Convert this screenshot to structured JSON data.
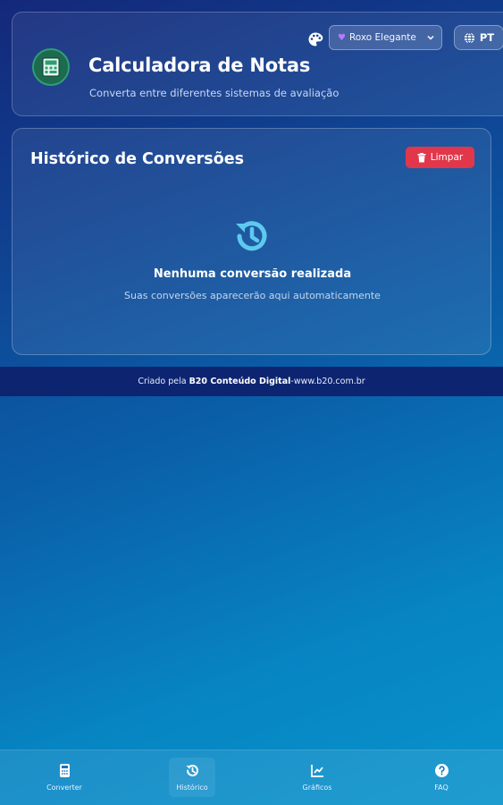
{
  "header": {
    "title": "Calculadora de Notas",
    "subtitle": "Converta entre diferentes sistemas de avaliação",
    "logo_icon": "calculator-grades-icon",
    "theme_select": {
      "value": "Roxo Elegante",
      "icon": "heart-icon"
    },
    "language_button": {
      "label": "PT",
      "icon": "globe-icon"
    },
    "palette_icon": "palette-icon"
  },
  "history": {
    "title": "Histórico de Conversões",
    "clear_button": "Limpar",
    "empty_title": "Nenhuma conversão realizada",
    "empty_subtitle": "Suas conversões aparecerão aqui automaticamente"
  },
  "footer": {
    "prefix": "Criado pela",
    "brand": "B20 Conteúdo Digital",
    "separator": " - ",
    "url": "www.b20.com.br"
  },
  "bottom_nav": [
    {
      "label": "Converter",
      "icon": "calculator-icon",
      "active": false
    },
    {
      "label": "Histórico",
      "icon": "history-icon",
      "active": true
    },
    {
      "label": "Gráficos",
      "icon": "chart-icon",
      "active": false
    },
    {
      "label": "FAQ",
      "icon": "help-circle-icon",
      "active": false
    }
  ],
  "colors": {
    "clear_button": "#e2374a",
    "footer_bar": "#0d2570",
    "logo_green": "#1c6a4f",
    "accent_purple": "#b57bff",
    "empty_icon": "#5ec9ee"
  }
}
